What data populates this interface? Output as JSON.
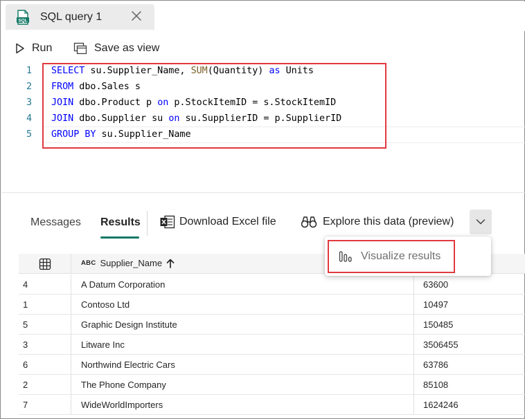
{
  "tab": {
    "title": "SQL query 1",
    "icon_text": "SQL"
  },
  "toolbar": {
    "run_label": "Run",
    "save_view_label": "Save as view"
  },
  "editor": {
    "lines": [
      {
        "number": "1",
        "segments": [
          {
            "t": "SELECT",
            "c": "kw"
          },
          {
            "t": " su.Supplier_Name, ",
            "c": ""
          },
          {
            "t": "SUM",
            "c": "fn"
          },
          {
            "t": "(Quantity) ",
            "c": ""
          },
          {
            "t": "as",
            "c": "kw"
          },
          {
            "t": " Units",
            "c": ""
          }
        ]
      },
      {
        "number": "2",
        "segments": [
          {
            "t": "FROM",
            "c": "kw"
          },
          {
            "t": " dbo.Sales s",
            "c": ""
          }
        ]
      },
      {
        "number": "3",
        "segments": [
          {
            "t": "JOIN",
            "c": "kw"
          },
          {
            "t": " dbo.Product p ",
            "c": ""
          },
          {
            "t": "on",
            "c": "kw"
          },
          {
            "t": " p.StockItemID = s.StockItemID",
            "c": ""
          }
        ]
      },
      {
        "number": "4",
        "segments": [
          {
            "t": "JOIN",
            "c": "kw"
          },
          {
            "t": " dbo.Supplier su ",
            "c": ""
          },
          {
            "t": "on",
            "c": "kw"
          },
          {
            "t": " su.SupplierID = p.SupplierID",
            "c": ""
          }
        ]
      },
      {
        "number": "5",
        "segments": [
          {
            "t": "GROUP BY",
            "c": "kw"
          },
          {
            "t": " su.Supplier_Name",
            "c": ""
          }
        ]
      }
    ]
  },
  "results_bar": {
    "messages_label": "Messages",
    "results_label": "Results",
    "excel_label": "Download Excel file",
    "explore_label": "Explore this data (preview)"
  },
  "dropdown": {
    "visualize_label": "Visualize results"
  },
  "grid": {
    "type_badge": "ABC",
    "column_header": "Supplier_Name",
    "rows": [
      {
        "idx": "4",
        "name": "A Datum Corporation",
        "units": "63600"
      },
      {
        "idx": "1",
        "name": "Contoso Ltd",
        "units": "10497"
      },
      {
        "idx": "5",
        "name": "Graphic Design Institute",
        "units": "150485"
      },
      {
        "idx": "3",
        "name": "Litware Inc",
        "units": "3506455"
      },
      {
        "idx": "6",
        "name": "Northwind Electric Cars",
        "units": "63786"
      },
      {
        "idx": "2",
        "name": "The Phone Company",
        "units": "85108"
      },
      {
        "idx": "7",
        "name": "WideWorldImporters",
        "units": "1624246"
      }
    ]
  },
  "colors": {
    "keyword": "#0000ff",
    "function": "#795e26",
    "accent": "#117865",
    "highlight": "#e0393e",
    "line_number": "#237893"
  }
}
